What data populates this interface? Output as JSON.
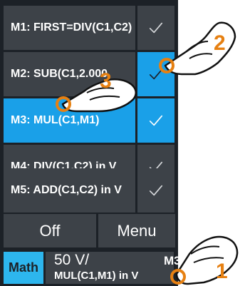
{
  "math_menu": {
    "items": [
      {
        "label": "M1: FIRST=DIV(C1,C2) i..",
        "enabled": true,
        "check_active": false,
        "selected": false
      },
      {
        "label": "M2: SUB(C1,2.000",
        "enabled": true,
        "check_active": true,
        "selected": false
      },
      {
        "label": "M3: MUL(C1,M1)",
        "enabled": true,
        "check_active": true,
        "selected": true
      },
      {
        "label": "M4: DIV(C1,C2) in V",
        "enabled": true,
        "check_active": false,
        "selected": false
      },
      {
        "label": "M5: ADD(C1,C2) in V",
        "enabled": true,
        "check_active": false,
        "selected": false
      }
    ],
    "off_label": "Off",
    "menu_label": "Menu"
  },
  "status_bar": {
    "tag": "Math",
    "scale": "50 V/",
    "function": "MUL(C1,M1) in V",
    "channel": "M3"
  },
  "callouts": [
    "1",
    "2",
    "3"
  ],
  "colors": {
    "panel_bg": "#1c2127",
    "item_bg": "#3d4248",
    "accent_blue": "#1aa0e8",
    "callout_orange": "#e68012"
  }
}
